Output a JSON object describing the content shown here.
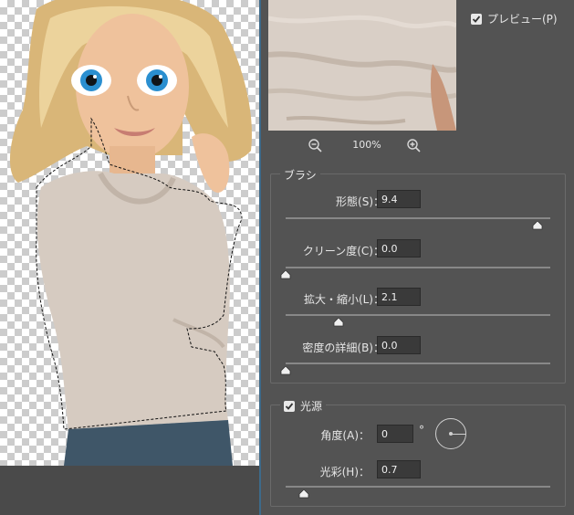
{
  "preview": {
    "label": "プレビュー(P)",
    "checked": true
  },
  "zoom": {
    "level": "100%"
  },
  "brush": {
    "title": "ブラシ",
    "params": [
      {
        "label": "形態(S)：",
        "value": "9.4",
        "slider": 0.95
      },
      {
        "label": "クリーン度(C)：",
        "value": "0.0",
        "slider": 0.0
      },
      {
        "label": "拡大・縮小(L)：",
        "value": "2.1",
        "slider": 0.2
      },
      {
        "label": "密度の詳細(B)：",
        "value": "0.0",
        "slider": 0.0
      }
    ]
  },
  "light": {
    "title": "光源",
    "checked": true,
    "angle": {
      "label": "角度(A)：",
      "value": "0",
      "unit": "°"
    },
    "shine": {
      "label": "光彩(H)：",
      "value": "0.7",
      "slider": 0.07
    }
  },
  "icons": {
    "zoom_out": "zoom-out-icon",
    "zoom_in": "zoom-in-icon",
    "check": "check-icon",
    "slider_thumb": "slider-thumb-icon"
  },
  "colors": {
    "panel_bg": "#535353",
    "input_bg": "#3a3a3a",
    "accent_divider": "#3d6a8a"
  }
}
